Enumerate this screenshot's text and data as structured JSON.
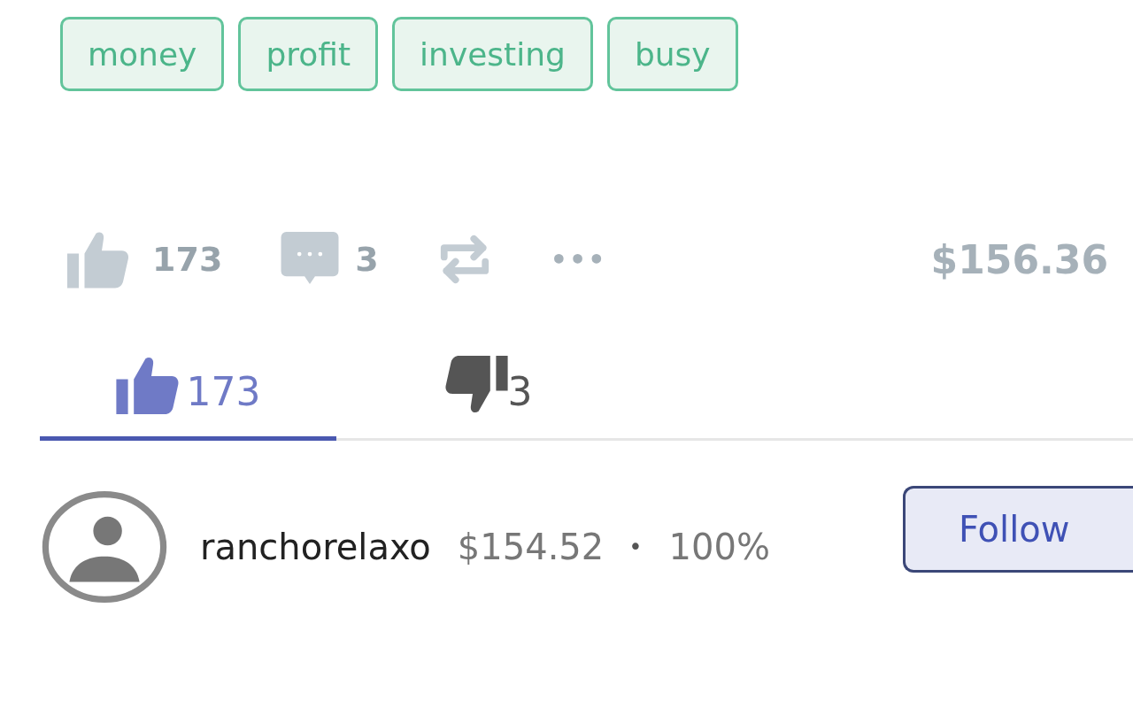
{
  "tags": [
    "money",
    "profit",
    "investing",
    "busy"
  ],
  "actions": {
    "likes": "173",
    "comments": "3",
    "more": "•••",
    "price": "$156.36"
  },
  "tabs": [
    {
      "kind": "like",
      "count": "173",
      "selected": true
    },
    {
      "kind": "dislike",
      "count": "3",
      "selected": false
    }
  ],
  "voter": {
    "name": "ranchorelaxo",
    "amount": "$154.52",
    "separator": "•",
    "percent": "100%",
    "button": "Follow"
  }
}
